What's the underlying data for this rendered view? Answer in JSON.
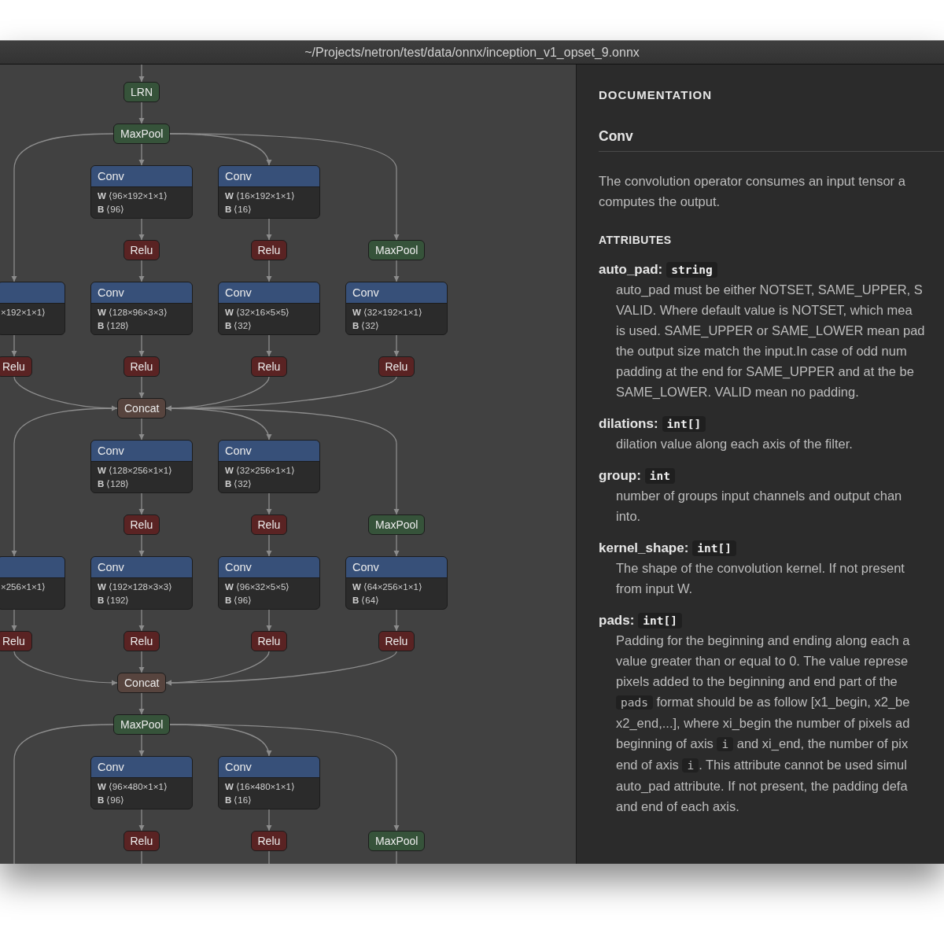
{
  "window": {
    "title": "~/Projects/netron/test/data/onnx/inception_v1_opset_9.onnx"
  },
  "graph": {
    "rows": [
      {
        "lane_1": {
          "type": "LRN",
          "kind": "normalization"
        }
      },
      {
        "lane_1": {
          "type": "MaxPool",
          "kind": "pool"
        }
      },
      {
        "lane_1": {
          "type": "Conv",
          "kind": "layer",
          "attributes": [
            {
              "name": "W",
              "value": "⟨96×192×1×1⟩"
            },
            {
              "name": "B",
              "value": "⟨96⟩"
            }
          ]
        },
        "lane_2": {
          "type": "Conv",
          "kind": "layer",
          "attributes": [
            {
              "name": "W",
              "value": "⟨16×192×1×1⟩"
            },
            {
              "name": "B",
              "value": "⟨16⟩"
            }
          ]
        }
      },
      {
        "lane_1": {
          "type": "Relu",
          "kind": "activation"
        },
        "lane_2": {
          "type": "Relu",
          "kind": "activation"
        },
        "lane_3": {
          "type": "MaxPool",
          "kind": "pool"
        }
      },
      {
        "edge_lane": {
          "kind": "layer",
          "attributes": [
            {
              "value": "×192×1×1⟩"
            }
          ]
        },
        "lane_1": {
          "type": "Conv",
          "kind": "layer",
          "attributes": [
            {
              "name": "W",
              "value": "⟨128×96×3×3⟩"
            },
            {
              "name": "B",
              "value": "⟨128⟩"
            }
          ]
        },
        "lane_2": {
          "type": "Conv",
          "kind": "layer",
          "attributes": [
            {
              "name": "W",
              "value": "⟨32×16×5×5⟩"
            },
            {
              "name": "B",
              "value": "⟨32⟩"
            }
          ]
        },
        "lane_3": {
          "type": "Conv",
          "kind": "layer",
          "attributes": [
            {
              "name": "W",
              "value": "⟨32×192×1×1⟩"
            },
            {
              "name": "B",
              "value": "⟨32⟩"
            }
          ]
        }
      },
      {
        "edge_lane": {
          "type": "Relu",
          "kind": "activation"
        },
        "lane_1": {
          "type": "Relu",
          "kind": "activation"
        },
        "lane_2": {
          "type": "Relu",
          "kind": "activation"
        },
        "lane_3": {
          "type": "Relu",
          "kind": "activation"
        }
      },
      {
        "lane_1": {
          "type": "Concat",
          "kind": "tensor"
        }
      },
      {
        "lane_1": {
          "type": "Conv",
          "kind": "layer",
          "attributes": [
            {
              "name": "W",
              "value": "⟨128×256×1×1⟩"
            },
            {
              "name": "B",
              "value": "⟨128⟩"
            }
          ]
        },
        "lane_2": {
          "type": "Conv",
          "kind": "layer",
          "attributes": [
            {
              "name": "W",
              "value": "⟨32×256×1×1⟩"
            },
            {
              "name": "B",
              "value": "⟨32⟩"
            }
          ]
        }
      },
      {
        "lane_1": {
          "type": "Relu",
          "kind": "activation"
        },
        "lane_2": {
          "type": "Relu",
          "kind": "activation"
        },
        "lane_3": {
          "type": "MaxPool",
          "kind": "pool"
        }
      },
      {
        "edge_lane": {
          "kind": "layer",
          "attributes": [
            {
              "value": "×256×1×1⟩"
            }
          ]
        },
        "lane_1": {
          "type": "Conv",
          "kind": "layer",
          "attributes": [
            {
              "name": "W",
              "value": "⟨192×128×3×3⟩"
            },
            {
              "name": "B",
              "value": "⟨192⟩"
            }
          ]
        },
        "lane_2": {
          "type": "Conv",
          "kind": "layer",
          "attributes": [
            {
              "name": "W",
              "value": "⟨96×32×5×5⟩"
            },
            {
              "name": "B",
              "value": "⟨96⟩"
            }
          ]
        },
        "lane_3": {
          "type": "Conv",
          "kind": "layer",
          "attributes": [
            {
              "name": "W",
              "value": "⟨64×256×1×1⟩"
            },
            {
              "name": "B",
              "value": "⟨64⟩"
            }
          ]
        }
      },
      {
        "edge_lane": {
          "type": "Relu",
          "kind": "activation"
        },
        "lane_1": {
          "type": "Relu",
          "kind": "activation"
        },
        "lane_2": {
          "type": "Relu",
          "kind": "activation"
        },
        "lane_3": {
          "type": "Relu",
          "kind": "activation"
        }
      },
      {
        "lane_1": {
          "type": "Concat",
          "kind": "tensor"
        }
      },
      {
        "lane_1": {
          "type": "MaxPool",
          "kind": "pool"
        }
      },
      {
        "lane_1": {
          "type": "Conv",
          "kind": "layer",
          "attributes": [
            {
              "name": "W",
              "value": "⟨96×480×1×1⟩"
            },
            {
              "name": "B",
              "value": "⟨96⟩"
            }
          ]
        },
        "lane_2": {
          "type": "Conv",
          "kind": "layer",
          "attributes": [
            {
              "name": "W",
              "value": "⟨16×480×1×1⟩"
            },
            {
              "name": "B",
              "value": "⟨16⟩"
            }
          ]
        }
      },
      {
        "lane_1": {
          "type": "Relu",
          "kind": "activation"
        },
        "lane_2": {
          "type": "Relu",
          "kind": "activation"
        },
        "lane_3": {
          "type": "MaxPool",
          "kind": "pool"
        }
      }
    ]
  },
  "documentation": {
    "heading": "DOCUMENTATION",
    "operator": "Conv",
    "description": [
      "The convolution operator consumes an input tensor a",
      "computes the output."
    ],
    "attributes_heading": "ATTRIBUTES",
    "attributes": [
      {
        "name": "auto_pad:",
        "type": "string",
        "lines": [
          "auto_pad must be either NOTSET, SAME_UPPER, S",
          "VALID. Where default value is NOTSET, which mea",
          "is used. SAME_UPPER or SAME_LOWER mean pad",
          "the output size match the input.In case of odd num",
          "padding at the end for SAME_UPPER and at the be",
          "SAME_LOWER. VALID mean no padding."
        ]
      },
      {
        "name": "dilations:",
        "type": "int[]",
        "lines": [
          "dilation value along each axis of the filter."
        ]
      },
      {
        "name": "group:",
        "type": "int",
        "lines": [
          "number of groups input channels and output chan",
          "into."
        ]
      },
      {
        "name": "kernel_shape:",
        "type": "int[]",
        "lines": [
          "The shape of the convolution kernel. If not present",
          "from input W."
        ]
      },
      {
        "name": "pads:",
        "type": "int[]",
        "lines": [
          "Padding for the beginning and ending along each a",
          "value greater than or equal to 0. The value represe",
          "pixels added to the beginning and end part of the",
          [
            {
              "kind": "code",
              "text": "pads"
            },
            {
              "kind": "text",
              "text": " format should be as follow [x1_begin, x2_be"
            }
          ],
          "x2_end,...], where xi_begin the number of pixels ad",
          [
            {
              "kind": "text",
              "text": "beginning of axis "
            },
            {
              "kind": "code",
              "text": "i"
            },
            {
              "kind": "text",
              "text": " and xi_end, the number of pix"
            }
          ],
          [
            {
              "kind": "text",
              "text": "end of axis "
            },
            {
              "kind": "code",
              "text": "i"
            },
            {
              "kind": "text",
              "text": ". This attribute cannot be used simul"
            }
          ],
          "auto_pad attribute. If not present, the padding defa",
          "and end of each axis."
        ]
      }
    ]
  }
}
